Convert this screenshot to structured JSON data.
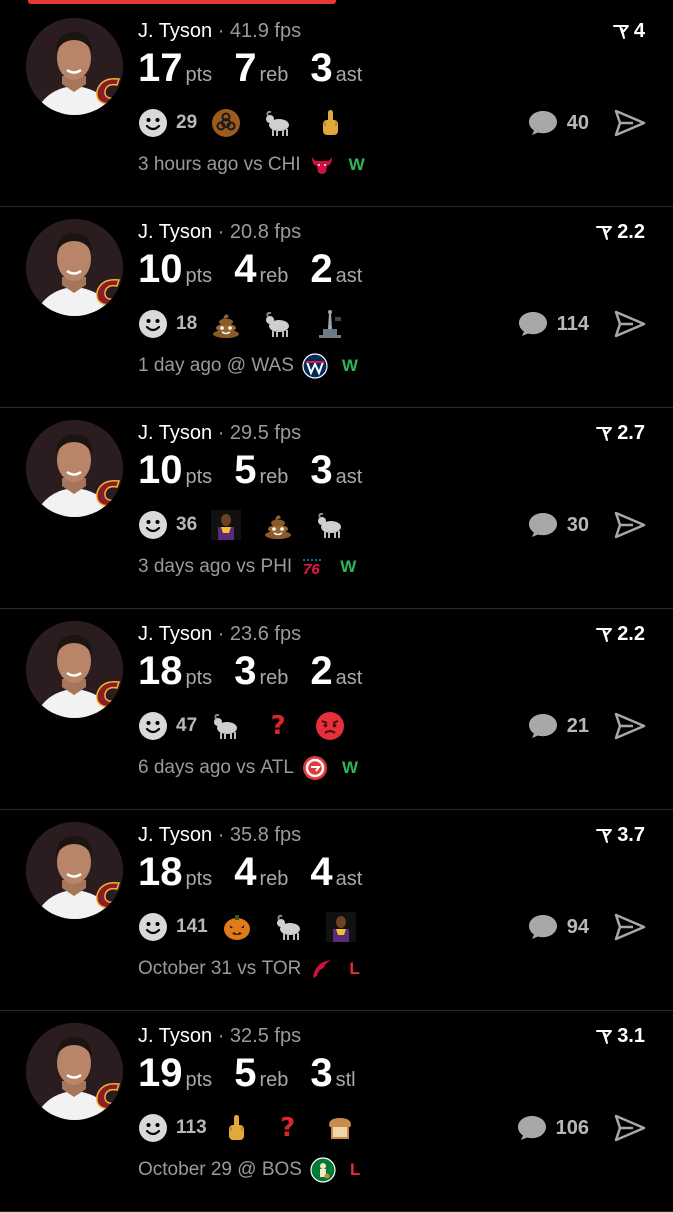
{
  "colors": {
    "win": "#2fb45a",
    "loss": "#e0302f",
    "accent": "#e53935",
    "muted": "#9a9a9a"
  },
  "posts": [
    {
      "player": "J. Tyson",
      "separator": "·",
      "fps": "41.9 fps",
      "score": "4",
      "stats": [
        {
          "num": "17",
          "unit": "pts"
        },
        {
          "num": "7",
          "unit": "reb"
        },
        {
          "num": "3",
          "unit": "ast"
        }
      ],
      "reaction_count": "29",
      "reaction_icons": [
        "biohazard-icon",
        "goat-icon",
        "middle-finger-icon"
      ],
      "comments": "40",
      "time": "3 hours ago",
      "venue": "vs",
      "opponent": "CHI",
      "opponent_icon": "bulls-logo-icon",
      "result": "W"
    },
    {
      "player": "J. Tyson",
      "separator": "·",
      "fps": "20.8 fps",
      "score": "2.2",
      "stats": [
        {
          "num": "10",
          "unit": "pts"
        },
        {
          "num": "4",
          "unit": "reb"
        },
        {
          "num": "2",
          "unit": "ast"
        }
      ],
      "reaction_count": "18",
      "reaction_icons": [
        "poop-icon",
        "goat-icon",
        "statue-icon"
      ],
      "comments": "114",
      "time": "1 day ago",
      "venue": "@",
      "opponent": "WAS",
      "opponent_icon": "wizards-logo-icon",
      "result": "W"
    },
    {
      "player": "J. Tyson",
      "separator": "·",
      "fps": "29.5 fps",
      "score": "2.7",
      "stats": [
        {
          "num": "10",
          "unit": "pts"
        },
        {
          "num": "5",
          "unit": "reb"
        },
        {
          "num": "3",
          "unit": "ast"
        }
      ],
      "reaction_count": "36",
      "reaction_icons": [
        "player-photo-icon",
        "poop-icon",
        "goat-icon"
      ],
      "comments": "30",
      "time": "3 days ago",
      "venue": "vs",
      "opponent": "PHI",
      "opponent_icon": "76ers-logo-icon",
      "result": "W"
    },
    {
      "player": "J. Tyson",
      "separator": "·",
      "fps": "23.6 fps",
      "score": "2.2",
      "stats": [
        {
          "num": "18",
          "unit": "pts"
        },
        {
          "num": "3",
          "unit": "reb"
        },
        {
          "num": "2",
          "unit": "ast"
        }
      ],
      "reaction_count": "47",
      "reaction_icons": [
        "goat-icon",
        "question-mark-icon",
        "angry-face-icon"
      ],
      "comments": "21",
      "time": "6 days ago",
      "venue": "vs",
      "opponent": "ATL",
      "opponent_icon": "hawks-logo-icon",
      "result": "W"
    },
    {
      "player": "J. Tyson",
      "separator": "·",
      "fps": "35.8 fps",
      "score": "3.7",
      "stats": [
        {
          "num": "18",
          "unit": "pts"
        },
        {
          "num": "4",
          "unit": "reb"
        },
        {
          "num": "4",
          "unit": "ast"
        }
      ],
      "reaction_count": "141",
      "reaction_icons": [
        "jack-o-lantern-icon",
        "goat-icon",
        "player-photo-icon"
      ],
      "comments": "94",
      "time": "October 31",
      "venue": "vs",
      "opponent": "TOR",
      "opponent_icon": "raptors-logo-icon",
      "result": "L"
    },
    {
      "player": "J. Tyson",
      "separator": "·",
      "fps": "32.5 fps",
      "score": "3.1",
      "stats": [
        {
          "num": "19",
          "unit": "pts"
        },
        {
          "num": "5",
          "unit": "reb"
        },
        {
          "num": "3",
          "unit": "stl"
        }
      ],
      "reaction_count": "113",
      "reaction_icons": [
        "middle-finger-icon",
        "question-mark-icon",
        "bread-icon"
      ],
      "comments": "106",
      "time": "October 29",
      "venue": "@",
      "opponent": "BOS",
      "opponent_icon": "celtics-logo-icon",
      "result": "L"
    }
  ]
}
